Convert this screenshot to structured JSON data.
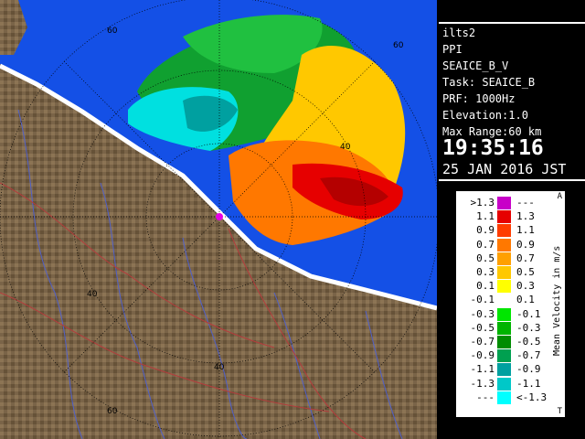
{
  "info": {
    "site": "ilts2",
    "product": "PPI",
    "dataset": "SEAICE_B_V",
    "task": "Task: SEAICE_B",
    "prf": "PRF: 1000Hz",
    "elevation": "Elevation:1.0",
    "max_range": "Max Range:60 km",
    "time": "19:35:16",
    "date": "25 JAN 2016 JST"
  },
  "legend": {
    "title": "Mean Velocity in m/s",
    "mark_top": "A",
    "mark_bottom": "T",
    "rows": [
      {
        "left": ">1.3",
        "right": "---",
        "color": "#c800c8"
      },
      {
        "left": "1.1",
        "right": "1.3",
        "color": "#e60000"
      },
      {
        "left": "0.9",
        "right": "1.1",
        "color": "#ff3c00"
      },
      {
        "left": "0.7",
        "right": "0.9",
        "color": "#ff7800"
      },
      {
        "left": "0.5",
        "right": "0.7",
        "color": "#ffa000"
      },
      {
        "left": "0.3",
        "right": "0.5",
        "color": "#ffc800"
      },
      {
        "left": "0.1",
        "right": "0.3",
        "color": "#ffff00"
      },
      {
        "left": "-0.1",
        "right": "0.1",
        "color": "#ffffff"
      },
      {
        "left": "-0.3",
        "right": "-0.1",
        "color": "#00e600"
      },
      {
        "left": "-0.5",
        "right": "-0.3",
        "color": "#00b400"
      },
      {
        "left": "-0.7",
        "right": "-0.5",
        "color": "#008c00"
      },
      {
        "left": "-0.9",
        "right": "-0.7",
        "color": "#00a050"
      },
      {
        "left": "-1.1",
        "right": "-0.9",
        "color": "#00a0a0"
      },
      {
        "left": "-1.3",
        "right": "-1.1",
        "color": "#00c8c8"
      },
      {
        "left": "---",
        "right": "<-1.3",
        "color": "#00ffff"
      }
    ]
  },
  "map": {
    "range_labels": [
      "60",
      "60",
      "40",
      "40",
      "40",
      "60"
    ],
    "colors": {
      "sea": "#1450e6",
      "land": "#7a6448",
      "land_light": "#9a8260",
      "river": "#5060c8",
      "road": "#b43c3c",
      "ring": "#000000"
    }
  }
}
